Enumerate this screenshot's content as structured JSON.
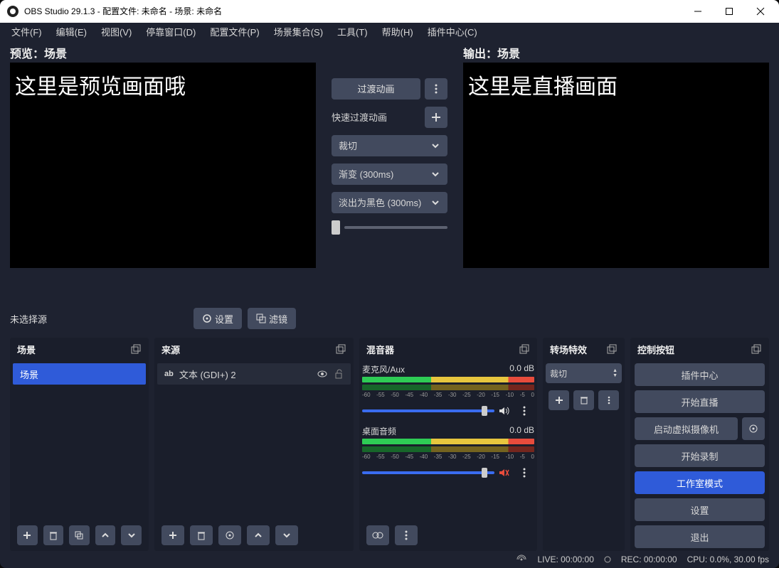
{
  "title": "OBS Studio 29.1.3 - 配置文件: 未命名 - 场景: 未命名",
  "menu": [
    "文件(F)",
    "编辑(E)",
    "视图(V)",
    "停靠窗口(D)",
    "配置文件(P)",
    "场景集合(S)",
    "工具(T)",
    "帮助(H)",
    "插件中心(C)"
  ],
  "preview_label": "预览：场景",
  "output_label": "输出：场景",
  "preview_text": "这里是预览画面哦",
  "output_text": "这里是直播画面",
  "transition": {
    "btn": "过渡动画",
    "quick_label": "快速过渡动画",
    "cut": "裁切",
    "fade": "渐变 (300ms)",
    "black": "淡出为黑色 (300ms)"
  },
  "toolbar": {
    "none": "未选择源",
    "props": "设置",
    "filters": "滤镜"
  },
  "panels": {
    "scenes": "场景",
    "sources": "来源",
    "mixer": "混音器",
    "trans": "转场特效",
    "controls": "控制按钮"
  },
  "scene_items": [
    "场景"
  ],
  "source_items": [
    {
      "icon": "ab",
      "name": "文本 (GDI+) 2"
    }
  ],
  "mixer": [
    {
      "name": "麦克风/Aux",
      "db": "0.0 dB",
      "muted": false
    },
    {
      "name": "桌面音频",
      "db": "0.0 dB",
      "muted": true
    }
  ],
  "ticks": [
    "-60",
    "-55",
    "-50",
    "-45",
    "-40",
    "-35",
    "-30",
    "-25",
    "-20",
    "-15",
    "-10",
    "-5",
    "0"
  ],
  "trans_select": "裁切",
  "controls": [
    {
      "label": "插件中心",
      "active": false
    },
    {
      "label": "开始直播",
      "active": false
    },
    {
      "label": "启动虚拟摄像机",
      "active": false,
      "gear": true
    },
    {
      "label": "开始录制",
      "active": false
    },
    {
      "label": "工作室模式",
      "active": true
    },
    {
      "label": "设置",
      "active": false
    },
    {
      "label": "退出",
      "active": false
    }
  ],
  "status": {
    "live": "LIVE: 00:00:00",
    "rec": "REC: 00:00:00",
    "cpu": "CPU: 0.0%, 30.00 fps"
  }
}
